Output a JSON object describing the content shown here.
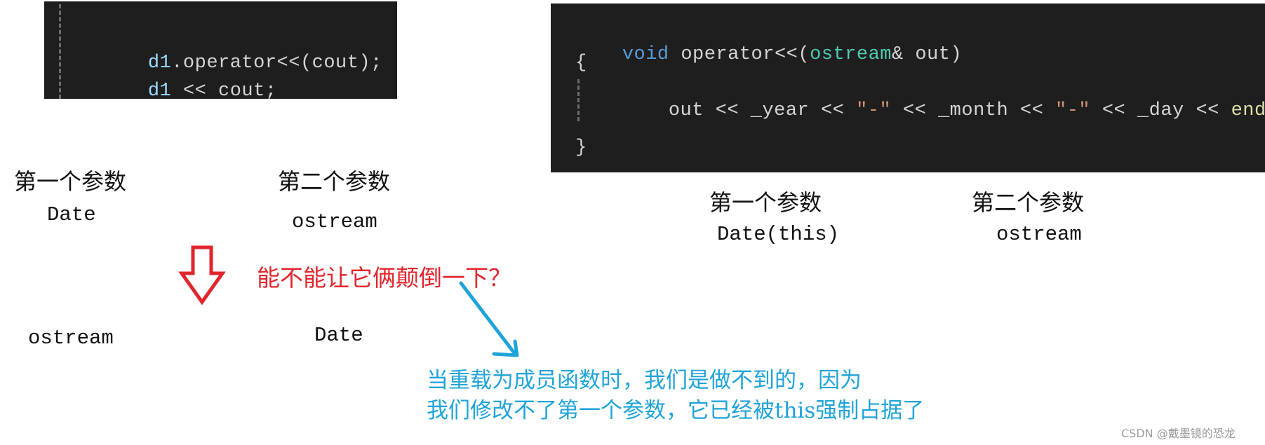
{
  "left_code": {
    "lines": [
      {
        "obj": "d1",
        "rest": ".operator<<(cout);"
      },
      {
        "obj": "d1",
        "rest": " << cout;"
      }
    ]
  },
  "right_code": {
    "line1": {
      "kw": "void",
      "name": " operator<<(",
      "type": "ostream",
      "rest": "& out)"
    },
    "open_brace": "{",
    "body": {
      "out": "out << _year << ",
      "str1": "\"-\"",
      "mid": " << _month << ",
      "str2": "\"-\"",
      "tail": " << _day << ",
      "endl": "endl",
      "semi": ";"
    },
    "close_brace": "}"
  },
  "left_params": {
    "first_heading": "第一个参数",
    "first_value": "Date",
    "second_heading": "第二个参数",
    "second_value": "ostream",
    "swapped_first": "ostream",
    "swapped_second": "Date"
  },
  "right_params": {
    "first_heading": "第一个参数",
    "first_value": "Date(this)",
    "second_heading": "第二个参数",
    "second_value": "ostream"
  },
  "question_note": "能不能让它俩颠倒一下？",
  "explanation": {
    "line1": "当重载为成员函数时，我们是做不到的，因为",
    "line2": "我们修改不了第一个参数，它已经被this强制占据了"
  },
  "watermark": "CSDN @戴墨镜的恐龙",
  "colors": {
    "code_bg": "#1e1e1e",
    "keyword": "#569cd6",
    "variable": "#9cdcfe",
    "type": "#4ec9b0",
    "string": "#ce9178",
    "function": "#dcdcaa",
    "red_accent": "#e0262d",
    "blue_accent": "#1fa3d8"
  },
  "icons": {
    "swap_arrow": "down-arrow-outline",
    "pointer_arrow": "diagonal-hand-drawn-arrow"
  }
}
